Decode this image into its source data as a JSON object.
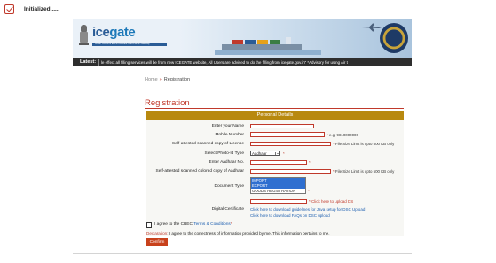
{
  "status": {
    "text": "Initialized....."
  },
  "header": {
    "logo_text_a": "ice",
    "logo_text_b": "gate",
    "logo_tagline": "Indian Customs Electronic Data Interchange Gateway"
  },
  "ticker": {
    "label": "Latest:",
    "text": "le effect all filling services will be from new ICEGATE website, All Users are advised to do the filling from icegate.gov.in\" *Advisory for using Air t"
  },
  "breadcrumb": {
    "home": "Home",
    "separator": "»",
    "current": "Registration"
  },
  "page": {
    "title": "Registration"
  },
  "form": {
    "section_title": "Personal Details",
    "fields": {
      "name_label": "Enter your Name",
      "name_value": "",
      "mobile_label": "Mobile Number",
      "mobile_value": "",
      "mobile_hint": "e.g. 9810000000",
      "license_label": "Self-attested scanned copy of License",
      "license_hint": "File Size Limit is upto 500 KB only",
      "photo_id_label": "Select Photo-Id Type",
      "photo_id_value": "Aadhaar",
      "aadhaar_label": "Enter Aadhaar No.",
      "aadhaar_value": "",
      "aadhaar_copy_label": "Self-attested scanned colored copy of Aadhaar",
      "aadhaar_copy_hint": "File Size Limit is upto 500 KB only",
      "doc_type_label": "Document Type",
      "doc_type_options": [
        "IMPORT",
        "EXPORT",
        "GOODS REGISTRATION"
      ],
      "digital_cert_label": "Digital Certificate",
      "upload_ds_link": "Click here to upload DS",
      "java_setup_link": "Click here to download guidelines for Java setup for DSC Upload",
      "faq_link": "Click here to download FAQs on DSC upload"
    },
    "agree_text": "I agree to the CBEC",
    "terms_link": "Terms & Conditions",
    "declaration_label": "Declaration:",
    "declaration_text": "I agree to the correctness of information provided by me. This information pertains to me.",
    "confirm_label": "Confirm"
  },
  "colors": {
    "accent": "#c0392b",
    "section_header": "#b8890f",
    "link": "#1d5fb0",
    "ticker_bg": "#2e2e2e"
  }
}
